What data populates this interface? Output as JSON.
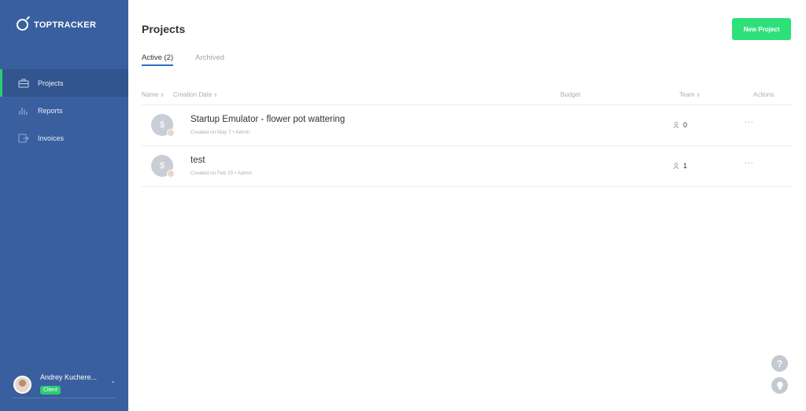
{
  "app": {
    "name": "TOPTRACKER"
  },
  "sidebar": {
    "items": [
      {
        "label": "Projects",
        "icon": "briefcase-icon",
        "active": true
      },
      {
        "label": "Reports",
        "icon": "bar-chart-icon",
        "active": false
      },
      {
        "label": "Invoices",
        "icon": "invoice-icon",
        "active": false
      }
    ],
    "user": {
      "name": "Andrey Kuchere...",
      "role": "Client"
    }
  },
  "header": {
    "title": "Projects",
    "new_button": "New Project"
  },
  "tabs": [
    {
      "label": "Active (2)",
      "active": true
    },
    {
      "label": "Archived",
      "active": false
    }
  ],
  "table": {
    "columns": {
      "name": "Name",
      "creation_date": "Creation Date",
      "budget": "Budget",
      "team": "Team",
      "actions": "Actions"
    },
    "rows": [
      {
        "name": "Startup Emulator - flower pot wattering",
        "meta": "Created on May 7 • Admin",
        "team": "0",
        "actions": "···"
      },
      {
        "name": "test",
        "meta": "Created on Feb 15 • Admin",
        "team": "1",
        "actions": "···"
      }
    ]
  },
  "colors": {
    "sidebar": "#3a5f9f",
    "accent": "#2ee07a",
    "tab_underline": "#2a70c8"
  }
}
